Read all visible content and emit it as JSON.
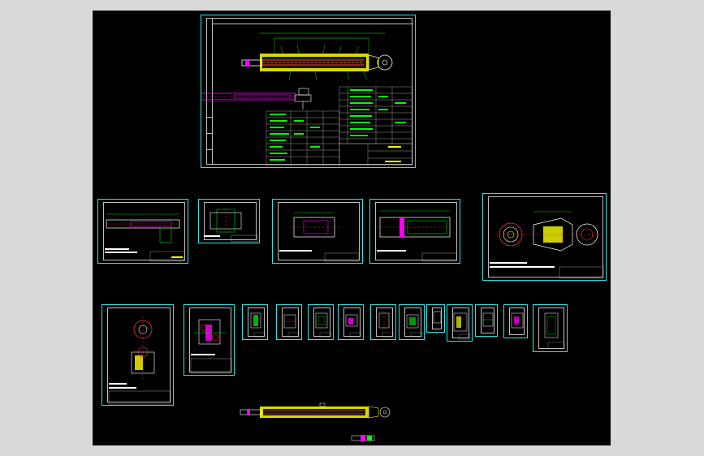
{
  "viewport": {
    "background": "#000000",
    "frame": "#d9d9d9"
  },
  "colors": {
    "border": "#2ee6e6",
    "drawing_green": "#00ff00",
    "drawing_yellow": "#ffff00",
    "drawing_magenta": "#ff00ff",
    "drawing_red": "#ff3030",
    "drawing_white": "#ffffff"
  },
  "sheets": [
    {
      "id": "assembly-main",
      "kind": "assembly-drawing-with-parts-list"
    },
    {
      "id": "part-piston-rod",
      "kind": "part-drawing"
    },
    {
      "id": "part-small-1",
      "kind": "part-drawing"
    },
    {
      "id": "part-cylinder-barrel",
      "kind": "part-drawing"
    },
    {
      "id": "part-cylinder-2",
      "kind": "part-drawing"
    },
    {
      "id": "part-end-cap",
      "kind": "part-drawing"
    },
    {
      "id": "part-clevis",
      "kind": "part-drawing"
    },
    {
      "id": "part-bracket",
      "kind": "part-drawing"
    },
    {
      "id": "part-seal-1",
      "kind": "part-drawing"
    },
    {
      "id": "part-seal-2",
      "kind": "part-drawing"
    },
    {
      "id": "part-seal-3",
      "kind": "part-drawing"
    },
    {
      "id": "part-seal-4",
      "kind": "part-drawing"
    },
    {
      "id": "part-seal-5",
      "kind": "part-drawing"
    },
    {
      "id": "part-seal-6",
      "kind": "part-drawing"
    },
    {
      "id": "part-seal-7",
      "kind": "part-drawing"
    },
    {
      "id": "part-seal-8",
      "kind": "part-drawing"
    },
    {
      "id": "part-seal-9",
      "kind": "part-drawing"
    },
    {
      "id": "part-seal-10",
      "kind": "part-drawing"
    },
    {
      "id": "part-seal-11",
      "kind": "part-drawing"
    }
  ],
  "loose_geometry": [
    {
      "id": "cylinder-assembly-view",
      "kind": "cylinder-assembly-sketch"
    },
    {
      "id": "small-part-view",
      "kind": "small-part-sketch"
    }
  ]
}
